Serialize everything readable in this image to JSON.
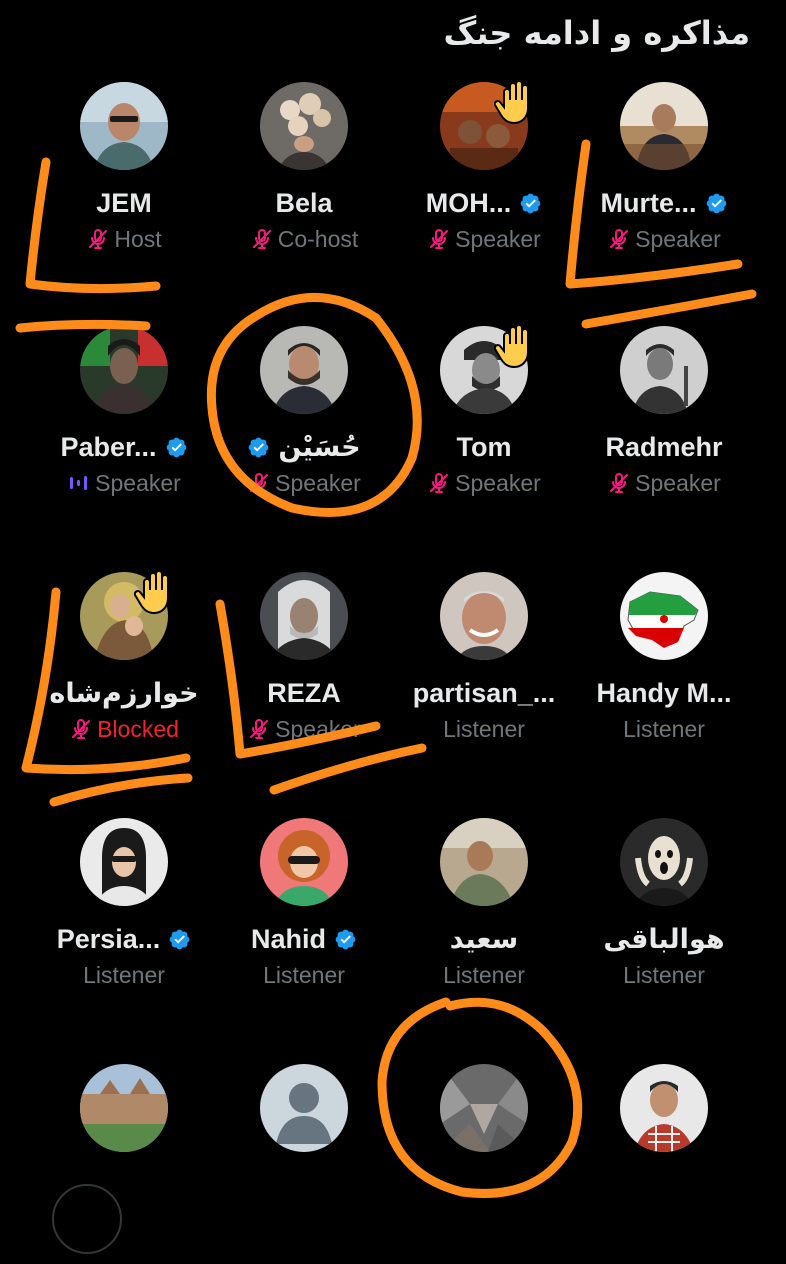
{
  "space": {
    "title": "مذاکره و ادامه جنگ"
  },
  "participants": [
    {
      "name": "JEM",
      "role": "Host",
      "verified": false,
      "mic": "muted"
    },
    {
      "name": "Bela",
      "role": "Co-host",
      "verified": false,
      "mic": "muted"
    },
    {
      "name": "MOH...",
      "role": "Speaker",
      "verified": true,
      "mic": "muted",
      "hand_raised": true
    },
    {
      "name": "Murte...",
      "role": "Speaker",
      "verified": true,
      "mic": "muted"
    },
    {
      "name": "Paber...",
      "role": "Speaker",
      "verified": true,
      "mic": "speaking"
    },
    {
      "name": "حُسَیْن",
      "role": "Speaker",
      "verified": true,
      "mic": "muted"
    },
    {
      "name": "Tom",
      "role": "Speaker",
      "verified": false,
      "mic": "muted",
      "hand_raised": true
    },
    {
      "name": "Radmehr",
      "role": "Speaker",
      "verified": false,
      "mic": "muted"
    },
    {
      "name": "خوارزم‌شاه",
      "role": "Blocked",
      "verified": false,
      "mic": "muted",
      "hand_raised": true
    },
    {
      "name": "REZA",
      "role": "Speaker",
      "verified": false,
      "mic": "muted"
    },
    {
      "name": "partisan_...",
      "role": "Listener",
      "verified": false
    },
    {
      "name": "Handy M...",
      "role": "Listener",
      "verified": false
    },
    {
      "name": "Persia...",
      "role": "Listener",
      "verified": true
    },
    {
      "name": "Nahid",
      "role": "Listener",
      "verified": true
    },
    {
      "name": "سعید",
      "role": "Listener",
      "verified": false
    },
    {
      "name": "هوالباقی",
      "role": "Listener",
      "verified": false
    }
  ],
  "colors": {
    "background": "#000000",
    "name": "#e7e9ea",
    "role": "#71767b",
    "blocked": "#f4212e",
    "muted_icon": "#f91880",
    "verified": "#1d9bf0",
    "speaking": "#7856ff",
    "hand": "#ffcc4d",
    "annotation": "#ff8c1a"
  },
  "icons": {
    "mic": "microphone-off-icon",
    "speaking": "speaking-bars-icon",
    "verified": "verified-badge-icon",
    "hand": "raised-hand-icon"
  }
}
